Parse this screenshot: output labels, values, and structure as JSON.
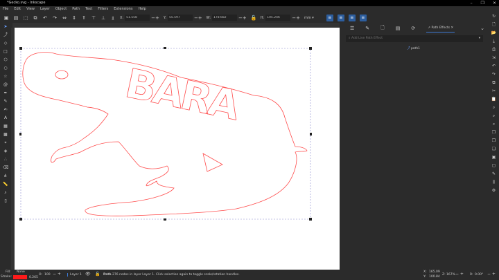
{
  "window": {
    "title": "*Gecko.svg - Inkscape",
    "controls": [
      "–",
      "❐",
      "✕"
    ]
  },
  "menu": [
    "File",
    "Edit",
    "View",
    "Layer",
    "Object",
    "Path",
    "Text",
    "Filters",
    "Extensions",
    "Help"
  ],
  "toolbar": {
    "x_label": "X:",
    "x": "51.558",
    "y_label": "Y:",
    "y": "55.597",
    "w_label": "W:",
    "w": "178.682",
    "h_label": "H:",
    "h": "105.246",
    "unit": "mm"
  },
  "canvas": {
    "text": "BARA",
    "stroke_color": "#ff3b3b"
  },
  "panel": {
    "tab_label": "Path Effects",
    "search_placeholder": "Add Live Path Effect",
    "item": "path1"
  },
  "status": {
    "fill_label": "Fill:",
    "fill_value": "None",
    "stroke_label": "Stroke:",
    "stroke_width": "0.265",
    "opacity_label": "O:",
    "opacity": "100",
    "layer": "Layer 1",
    "message_bold": "Path",
    "message": "276 nodes in layer Layer 1. Click selection again to toggle scale/rotation handles.",
    "cursor_x_label": "X:",
    "cursor_x": "165.09",
    "cursor_y_label": "Y:",
    "cursor_y": "100.84",
    "zoom_label": "Z:",
    "zoom": "167%",
    "rotate_label": "R:",
    "rotate": "0.00°"
  }
}
